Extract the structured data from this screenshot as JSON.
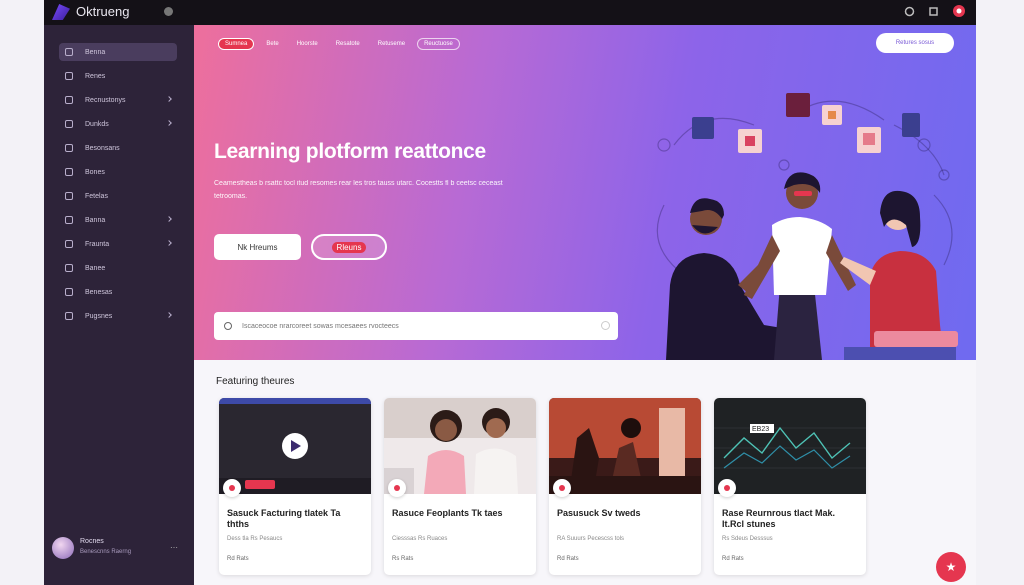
{
  "app": {
    "name": "Oktrueng"
  },
  "sidebar": {
    "items": [
      {
        "label": "Benna",
        "active": true
      },
      {
        "label": "Renes"
      },
      {
        "label": "Recnustonys"
      },
      {
        "label": "Dunkds"
      },
      {
        "label": "Besonsans"
      },
      {
        "label": "Bones"
      },
      {
        "label": "Fetelas"
      },
      {
        "label": "Banna"
      },
      {
        "label": "Fraunta"
      },
      {
        "label": "Banee"
      },
      {
        "label": "Benesas"
      },
      {
        "label": "Pugsnes"
      }
    ],
    "user": {
      "name": "Rocnes",
      "role": "Benescnns Raerng",
      "more": "⋯"
    }
  },
  "hero": {
    "tabs": [
      {
        "label": "Sumnea",
        "style": "active"
      },
      {
        "label": "Bete"
      },
      {
        "label": "Hoorste"
      },
      {
        "label": "Resatote"
      },
      {
        "label": "Retuseme"
      },
      {
        "label": "Reuctuose",
        "style": "outline"
      }
    ],
    "top_button": "Retures sosus",
    "title": "Learning plotform reattonce",
    "subtitle": "Ceamestheas b rsattc tocl itud resomes rear les tros tauss utarc. Cocestts fl b ceetsc ceceast tetroomas.",
    "cta_primary": "Nk Hreums",
    "cta_secondary": "Rleuns",
    "search": {
      "placeholder": "Iscaceocoe nrarcoreet sowas mcesaees rvocteecs"
    }
  },
  "content": {
    "section_title": "Featuring theures",
    "cards": [
      {
        "title": "Sasuck Facturing tlatek Ta thths",
        "meta": "Dess tla  Rs  Pesaucs",
        "foot": "Rd  Rats",
        "thumb": "video"
      },
      {
        "title": "Rasuce Feoplants Tk taes",
        "meta": "Ciesssas Rs  Ruaces",
        "foot": "Rs  Rats",
        "thumb": "people"
      },
      {
        "title": "Pasusuck Sv tweds",
        "meta": "RA  Suuurs Pecescss tols",
        "foot": "Rd  Rats",
        "thumb": "lab"
      },
      {
        "title": "Rase Reurnrous tlact Mak. It.Rcl stunes",
        "meta": "Rs  Sdeus  Desssus",
        "foot": "Rd  Rats",
        "thumb": "chart",
        "chart_label": "EB23"
      }
    ]
  },
  "colors": {
    "accent": "#e5364f",
    "sidebar": "#2d2339",
    "topbar": "#141117"
  }
}
